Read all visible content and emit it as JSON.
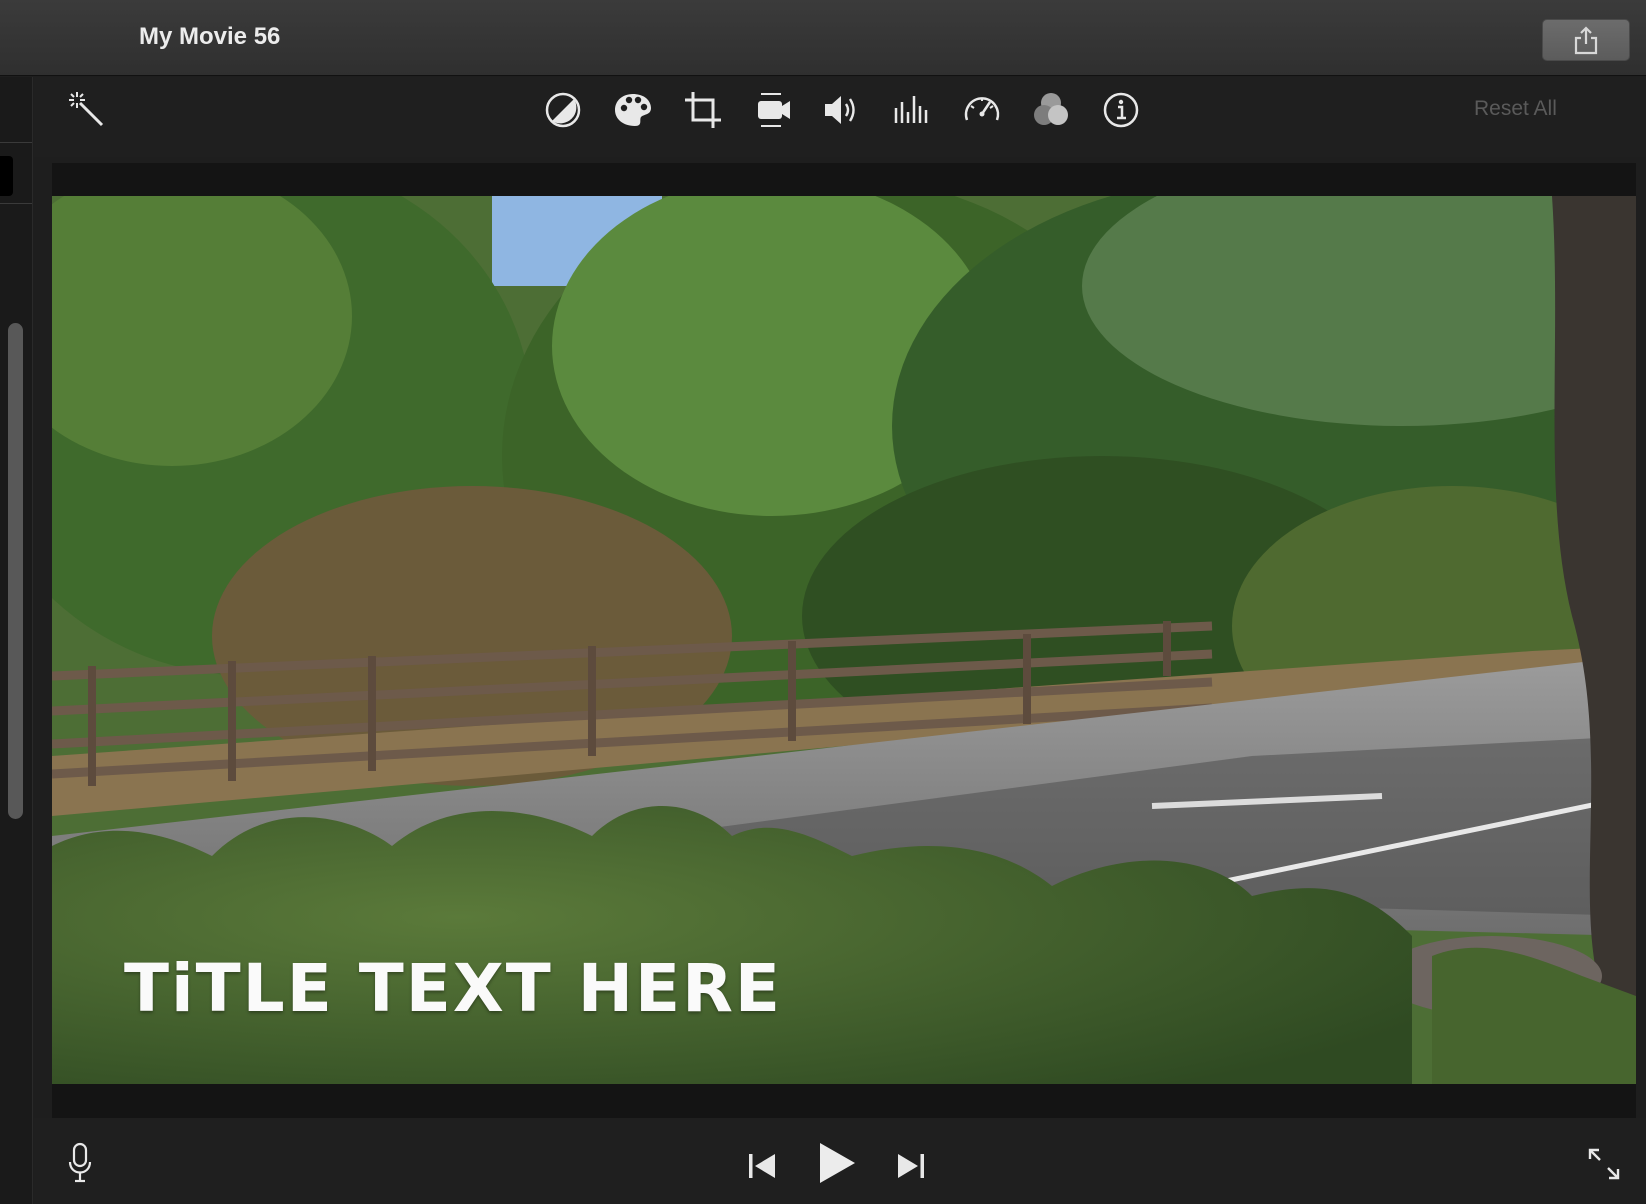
{
  "window": {
    "title": "My Movie 56",
    "share_icon": "share-icon"
  },
  "toolbar": {
    "magic_wand_icon": "magic-wand-icon",
    "tools": [
      {
        "name": "color-balance-icon"
      },
      {
        "name": "color-correction-icon"
      },
      {
        "name": "crop-icon"
      },
      {
        "name": "stabilization-icon"
      },
      {
        "name": "volume-icon"
      },
      {
        "name": "noise-reduction-equalizer-icon"
      },
      {
        "name": "speed-icon"
      },
      {
        "name": "clip-filter-icon"
      },
      {
        "name": "info-icon"
      }
    ],
    "reset_label": "Reset All"
  },
  "viewer": {
    "title_overlay": "TiTLE TEXT HERE"
  },
  "controls": {
    "icons": [
      "microphone-icon",
      "skip-back-icon",
      "play-icon",
      "skip-forward-icon",
      "fullscreen-icon"
    ]
  },
  "colors": {
    "background": "#1e1e1e",
    "titlebar": "#353535",
    "icon": "#e8e8e8",
    "reset_disabled": "#5a5a5a"
  }
}
